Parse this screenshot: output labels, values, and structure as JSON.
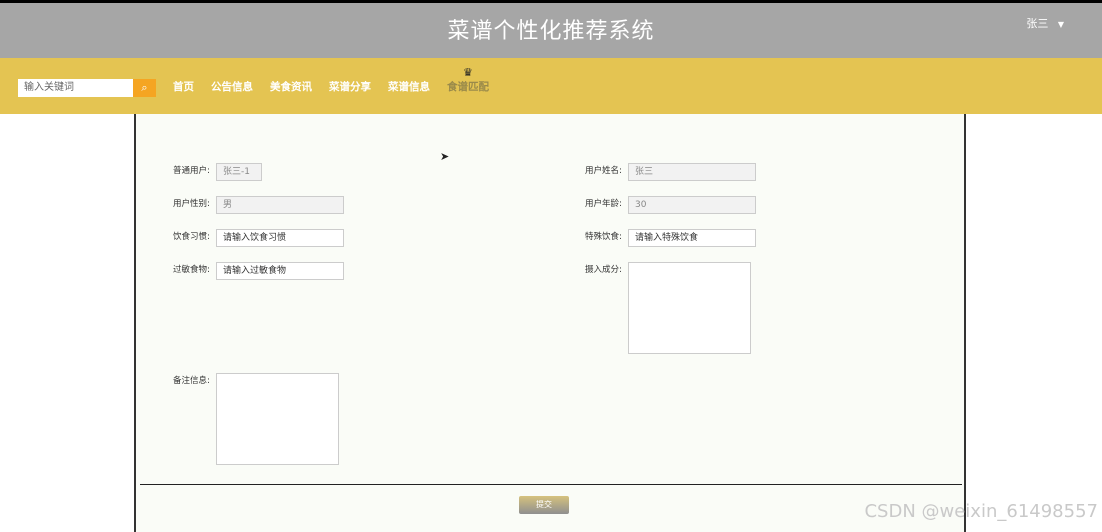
{
  "header": {
    "title": "菜谱个性化推荐系统",
    "user_name": "张三"
  },
  "nav": {
    "search_placeholder": "输入关键词",
    "items": [
      "首页",
      "公告信息",
      "美食资讯",
      "菜谱分享",
      "菜谱信息",
      "食谱匹配"
    ]
  },
  "form": {
    "user_account_label": "普通用户:",
    "user_account_value": "张三-1",
    "user_name_label": "用户姓名:",
    "user_name_value": "张三",
    "gender_label": "用户性别:",
    "gender_value": "男",
    "age_label": "用户年龄:",
    "age_value": "30",
    "diet_habit_label": "饮食习惯:",
    "diet_habit_placeholder": "请输入饮食习惯",
    "special_diet_label": "特殊饮食:",
    "special_diet_placeholder": "请输入特殊饮食",
    "allergy_label": "过敏食物:",
    "allergy_placeholder": "请输入过敏食物",
    "intake_label": "摄入成分:",
    "notes_label": "备注信息:",
    "submit_label": "提交"
  },
  "watermark": "CSDN @weixin_61498557"
}
